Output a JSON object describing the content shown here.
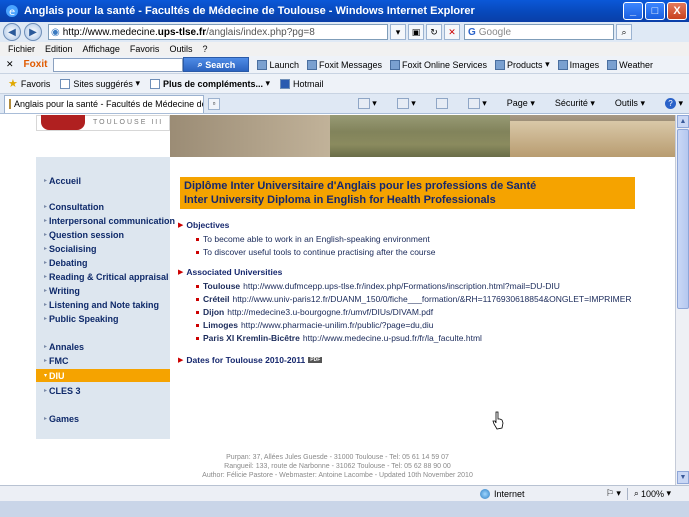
{
  "window": {
    "title": "Anglais pour la santé - Facultés de Médecine de Toulouse - Windows Internet Explorer",
    "minimize": "_",
    "maximize": "□",
    "close": "X"
  },
  "address": {
    "url_prefix": "http://www.medecine.",
    "url_domain": "ups-tlse.fr",
    "url_suffix": "/anglais/index.php?pg=8",
    "search_engine": "Google",
    "search_placeholder": "Google"
  },
  "menu": [
    "Fichier",
    "Edition",
    "Affichage",
    "Favoris",
    "Outils",
    "?"
  ],
  "foxit": {
    "logo": "Foxit",
    "search_label": "Search",
    "items": [
      "Launch",
      "Foxit Messages",
      "Foxit Online Services",
      "Products",
      "Images",
      "Weather"
    ]
  },
  "favorites": {
    "label": "Favoris",
    "items": [
      "Sites suggérés",
      "Plus de compléments...",
      "Hotmail"
    ]
  },
  "tab": {
    "label": "Anglais pour la santé - Facultés de Médecine de Toulo...",
    "commands": [
      "Page",
      "Sécurité",
      "Outils"
    ]
  },
  "logo": {
    "text": "TOULOUSE III"
  },
  "sidebar": {
    "items": [
      {
        "label": "Accueil",
        "active": false
      },
      {
        "label": "Consultation",
        "active": false
      },
      {
        "label": "Interpersonal communication",
        "active": false
      },
      {
        "label": "Question session",
        "active": false
      },
      {
        "label": "Socialising",
        "active": false
      },
      {
        "label": "Debating",
        "active": false
      },
      {
        "label": "Reading & Critical appraisal",
        "active": false
      },
      {
        "label": "Writing",
        "active": false
      },
      {
        "label": "Listening and Note taking",
        "active": false
      },
      {
        "label": "Public Speaking",
        "active": false
      },
      {
        "label": "Annales",
        "active": false
      },
      {
        "label": "FMC",
        "active": false
      },
      {
        "label": "DIU",
        "active": true
      },
      {
        "label": "CLES 3",
        "active": false
      },
      {
        "label": "Games",
        "active": false
      }
    ]
  },
  "main": {
    "heading_line1": "Diplôme Inter Universitaire d'Anglais pour les professions de Santé",
    "heading_line2": "Inter University Diploma in English for Health Professionals",
    "objectives_title": "Objectives",
    "objectives": [
      "To become able to work in an English-speaking environment",
      "To discover useful tools to continue practising after the course"
    ],
    "universities_title": "Associated Universities",
    "universities": [
      {
        "name": "Toulouse",
        "url": "http://www.dufmcepp.ups-tlse.fr/index.php/Formations/inscription.html?mail=DU-DIU"
      },
      {
        "name": "Créteil",
        "url": "http://www.univ-paris12.fr/DUANM_150/0/fiche___formation/&RH=1176930618854&ONGLET=IMPRIMER"
      },
      {
        "name": "Dijon",
        "url": "http://medecine3.u-bourgogne.fr/umvf/DIUs/DIVAM.pdf"
      },
      {
        "name": "Limoges",
        "url": "http://www.pharmacie-unilim.fr/public/?page=du,diu"
      },
      {
        "name": "Paris XI Kremlin-Bicêtre",
        "url": "http://www.medecine.u-psud.fr/fr/la_faculte.html"
      }
    ],
    "dates_title": "Dates for Toulouse 2010-2011",
    "pdf_label": "PDF"
  },
  "footer": {
    "line1": "Purpan: 37, Allées Jules Guesde - 31000 Toulouse - Tel: 05 61 14 59 07",
    "line2": "Rangueil: 133, route de Narbonne - 31062 Toulouse - Tel: 05 62 88 90 00",
    "line3": "Author: Félicie Pastore   -   Webmaster: Antoine Lacombe   -   Updated 10th November 2010"
  },
  "status": {
    "zone": "Internet",
    "zoom": "100%"
  }
}
